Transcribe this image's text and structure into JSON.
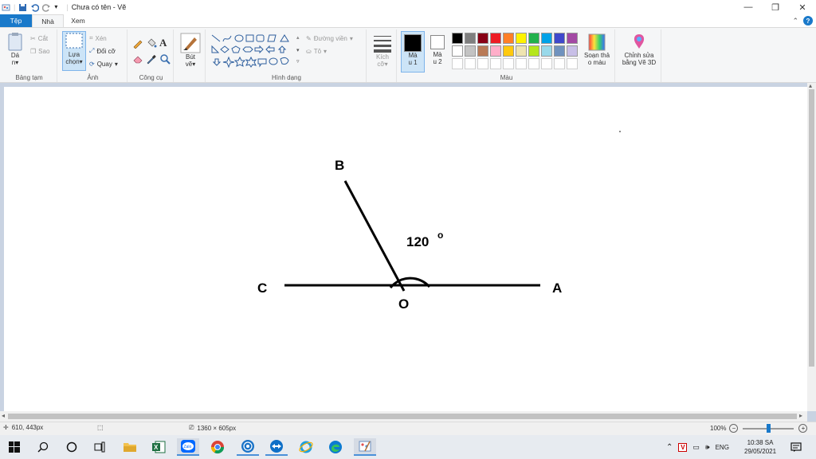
{
  "window": {
    "title": "Chưa có tên - Vẽ",
    "controls": {
      "minimize": "—",
      "restore": "❐",
      "close": "✕"
    }
  },
  "tabs": [
    {
      "label": "Tệp"
    },
    {
      "label": "Nhà"
    },
    {
      "label": "Xem"
    }
  ],
  "ribbon": {
    "clipboard": {
      "group_label": "Bảng tạm",
      "paste_line1": "Dá",
      "paste_line2": "n",
      "cut": "Cắt",
      "copy": "Sao"
    },
    "image": {
      "group_label": "Ảnh",
      "select_line1": "Lựa",
      "select_line2": "chọn",
      "crop": "Xén",
      "resize": "Đổi cỡ",
      "rotate": "Quay"
    },
    "tools": {
      "group_label": "Công cụ"
    },
    "brushes": {
      "label_line1": "Bút",
      "label_line2": "vẽ"
    },
    "shapes": {
      "group_label": "Hình dạng",
      "outline": "Đường viền",
      "fill": "Tô"
    },
    "size": {
      "label_line1": "Kích",
      "label_line2": "cỡ"
    },
    "colors": {
      "group_label": "Màu",
      "color1_line1": "Mà",
      "color1_line2": "u 1",
      "color2_line1": "Mà",
      "color2_line2": "u 2",
      "color1_value": "#000000",
      "color2_value": "#ffffff",
      "palette_row1": [
        "#000000",
        "#7f7f7f",
        "#880015",
        "#ed1c24",
        "#ff7f27",
        "#fff200",
        "#22b14c",
        "#00a2e8",
        "#3f48cc",
        "#a349a4"
      ],
      "palette_row2": [
        "#ffffff",
        "#c3c3c3",
        "#b97a57",
        "#ffaec9",
        "#ffc90e",
        "#efe4b0",
        "#b5e61d",
        "#99d9ea",
        "#7092be",
        "#c8bfe7"
      ],
      "edit_colors_line1": "Soạn thả",
      "edit_colors_line2": "o màu"
    },
    "paint3d": {
      "label_line1": "Chỉnh sửa",
      "label_line2": "bằng Vẽ 3D"
    }
  },
  "drawing": {
    "label_A": "A",
    "label_B": "B",
    "label_C": "C",
    "label_O": "O",
    "angle_text": "120",
    "degree_mark": "o"
  },
  "statusbar": {
    "cursor_pos": "610, 443px",
    "canvas_size": "1360 × 605px",
    "zoom": "100%"
  },
  "taskbar": {
    "language": "ENG",
    "time": "10:38 SA",
    "date": "29/05/2021"
  }
}
